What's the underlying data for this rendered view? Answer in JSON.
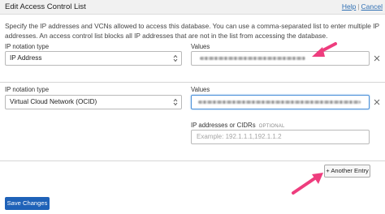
{
  "header": {
    "title": "Edit Access Control List",
    "help_link": "Help",
    "separator": "|",
    "cancel_link": "Cancel"
  },
  "description": "Specify the IP addresses and VCNs allowed to access this database. You can use a comma-separated list to enter multiple IP addresses. An access control list blocks all IP addresses that are not in the list from accessing the database.",
  "entries": [
    {
      "notation_label": "IP notation type",
      "notation_value": "IP Address",
      "values_label": "Values"
    },
    {
      "notation_label": "IP notation type",
      "notation_value": "Virtual Cloud Network (OCID)",
      "values_label": "Values",
      "cidr_label": "IP addresses or CIDRs",
      "cidr_optional": "OPTIONAL",
      "cidr_placeholder": "Example: 192.1.1.1,192.1.1.2"
    }
  ],
  "buttons": {
    "add_entry": "+ Another Entry",
    "save": "Save Changes"
  },
  "icons": {
    "remove": "close-icon",
    "select": "chevron-updown-icon",
    "annotation": "pink-arrow-icon"
  },
  "colors": {
    "accent": "#1f62b8",
    "link": "#2f6fb3",
    "focus": "#4a90d9",
    "annotation": "#ee3d7e"
  }
}
